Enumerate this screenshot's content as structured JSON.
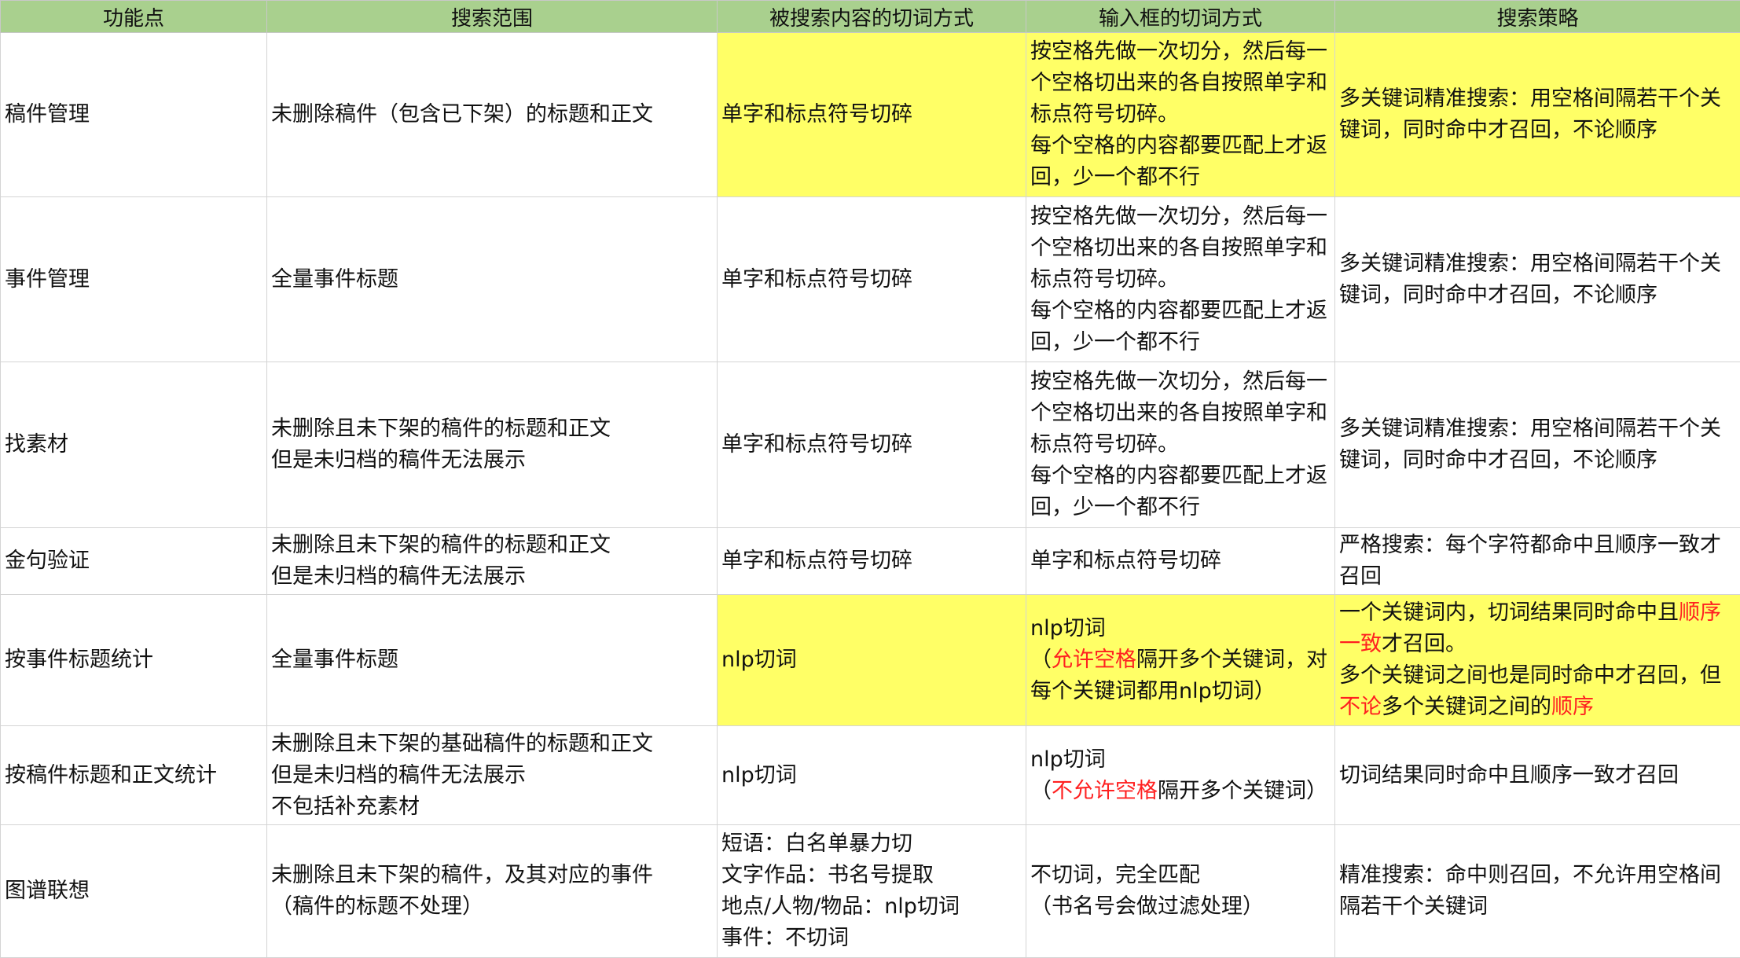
{
  "headers": [
    "功能点",
    "搜索范围",
    "被搜索内容的切词方式",
    "输入框的切词方式",
    "搜索策略"
  ],
  "colors": {
    "header_bg": "#a9d08e",
    "highlight": "#ffff66",
    "emphasis_text": "#ff2020"
  },
  "rows": [
    {
      "feature": "稿件管理",
      "scope": [
        "未删除稿件（包含已下架）的标题和正文"
      ],
      "content_tokenization": [
        "单字和标点符号切碎"
      ],
      "input_tokenization": [
        "按空格先做一次切分，然后每一个空格切出来的各自按照单字和标点符号切碎。",
        "每个空格的内容都要匹配上才返回，少一个都不行"
      ],
      "strategy": [
        "多关键词精准搜索：用空格间隔若干个关键词，同时命中才召回，不论顺序"
      ]
    },
    {
      "feature": "事件管理",
      "scope": [
        "全量事件标题"
      ],
      "content_tokenization": [
        "单字和标点符号切碎"
      ],
      "input_tokenization": [
        "按空格先做一次切分，然后每一个空格切出来的各自按照单字和标点符号切碎。",
        "每个空格的内容都要匹配上才返回，少一个都不行"
      ],
      "strategy": [
        "多关键词精准搜索：用空格间隔若干个关键词，同时命中才召回，不论顺序"
      ]
    },
    {
      "feature": "找素材",
      "scope": [
        "未删除且未下架的稿件的标题和正文",
        "但是未归档的稿件无法展示"
      ],
      "content_tokenization": [
        "单字和标点符号切碎"
      ],
      "input_tokenization": [
        "按空格先做一次切分，然后每一个空格切出来的各自按照单字和标点符号切碎。",
        "每个空格的内容都要匹配上才返回，少一个都不行"
      ],
      "strategy": [
        "多关键词精准搜索：用空格间隔若干个关键词，同时命中才召回，不论顺序"
      ]
    },
    {
      "feature": "金句验证",
      "scope": [
        "未删除且未下架的稿件的标题和正文",
        "但是未归档的稿件无法展示"
      ],
      "content_tokenization": [
        "单字和标点符号切碎"
      ],
      "input_tokenization": [
        "单字和标点符号切碎"
      ],
      "strategy": [
        "严格搜索：每个字符都命中且顺序一致才召回"
      ]
    },
    {
      "feature": "按事件标题统计",
      "scope": [
        "全量事件标题"
      ],
      "content_tokenization": [
        "nlp切词"
      ],
      "input_tokenization": [
        "nlp切词"
      ],
      "input_note": {
        "open": "（",
        "red": "允许空格",
        "rest": "隔开多个关键词，对每个关键词都用nlp切词）"
      },
      "strategy_parts": {
        "p1": "一个关键词内，切词结果同时命中且",
        "p1_red": "顺序一致",
        "p1_end": "才召回。",
        "p2": "多个关键词之间也是同时命中才召回，但",
        "p2_red": "不论",
        "p2_mid": "多个关键词之间的",
        "p2_red2": "顺序"
      }
    },
    {
      "feature": "按稿件标题和正文统计",
      "scope": [
        "未删除且未下架的基础稿件的标题和正文",
        "但是未归档的稿件无法展示",
        "不包括补充素材"
      ],
      "content_tokenization": [
        "nlp切词"
      ],
      "input_tokenization": [
        "nlp切词"
      ],
      "input_note": {
        "open": "（",
        "red": "不允许空格",
        "rest": "隔开多个关键词）"
      },
      "strategy": [
        "切词结果同时命中且顺序一致才召回"
      ]
    },
    {
      "feature": "图谱联想",
      "scope": [
        "未删除且未下架的稿件，及其对应的事件",
        "（稿件的标题不处理）"
      ],
      "content_tokenization": [
        "短语：白名单暴力切",
        "文字作品：书名号提取",
        "地点/人物/物品：nlp切词",
        "事件：不切词"
      ],
      "input_tokenization": [
        "不切词，完全匹配",
        "（书名号会做过滤处理）"
      ],
      "strategy": [
        "精准搜索：命中则召回，不允许用空格间隔若干个关键词"
      ]
    }
  ]
}
